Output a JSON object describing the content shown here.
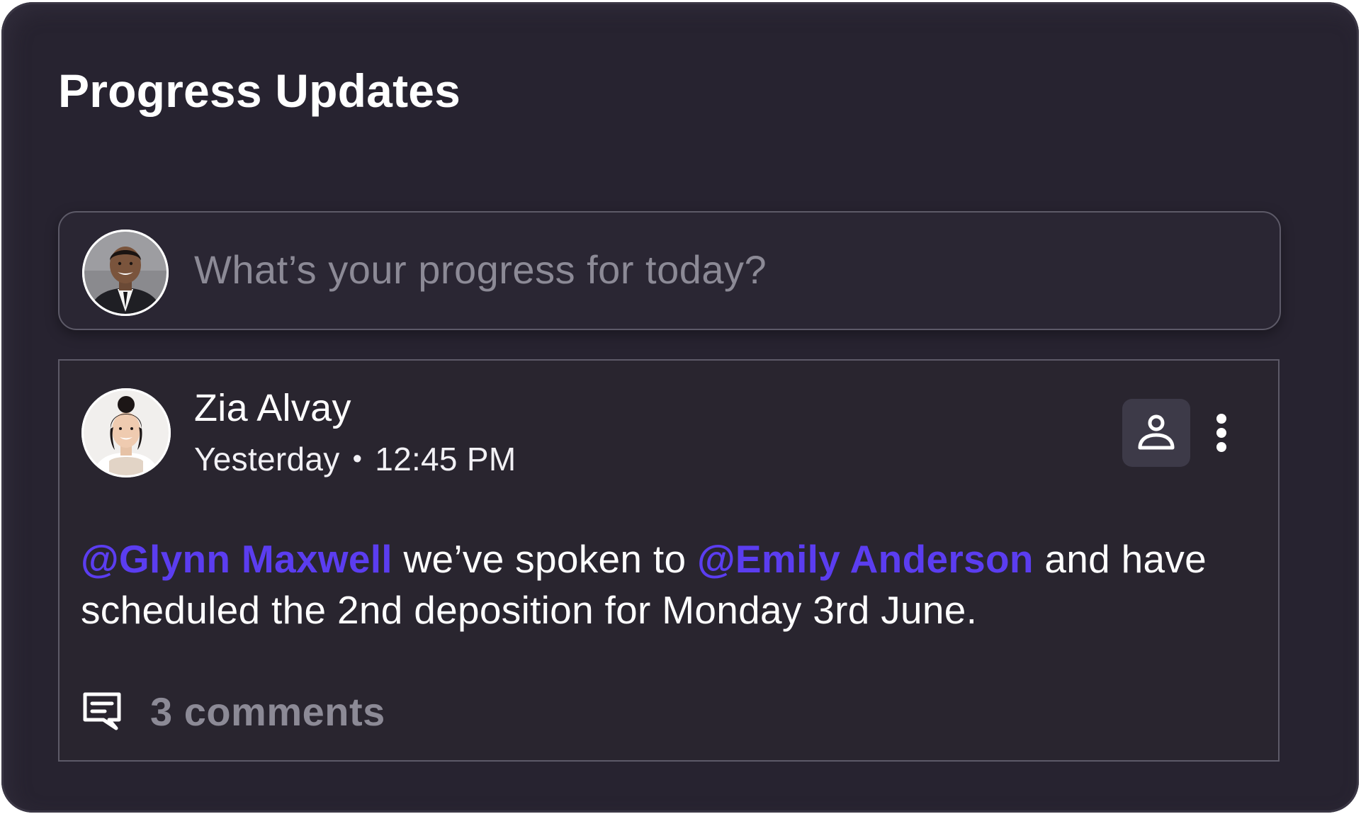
{
  "widget": {
    "title": "Progress Updates"
  },
  "composer": {
    "placeholder": "What’s your progress for today?",
    "avatar_icon": "user-avatar-photo"
  },
  "post": {
    "author": "Zia Alvay",
    "day": "Yesterday",
    "separator": "•",
    "time": "12:45 PM",
    "avatar_icon": "author-avatar-photo",
    "assign_icon": "person-icon",
    "more_icon": "more-vertical-icon",
    "mention_1": "@Glynn Maxwell",
    "text_1": " we’ve spoken to ",
    "mention_2": "@Emily Anderson",
    "text_2": " and have scheduled the 2nd deposition for Monday 3rd June.",
    "comments_icon": "comment-icon",
    "comments_label": "3 comments"
  },
  "colors": {
    "background": "#272330",
    "mention": "#5b3df0",
    "muted_text": "#8c8a96",
    "border": "#5d5a68"
  }
}
